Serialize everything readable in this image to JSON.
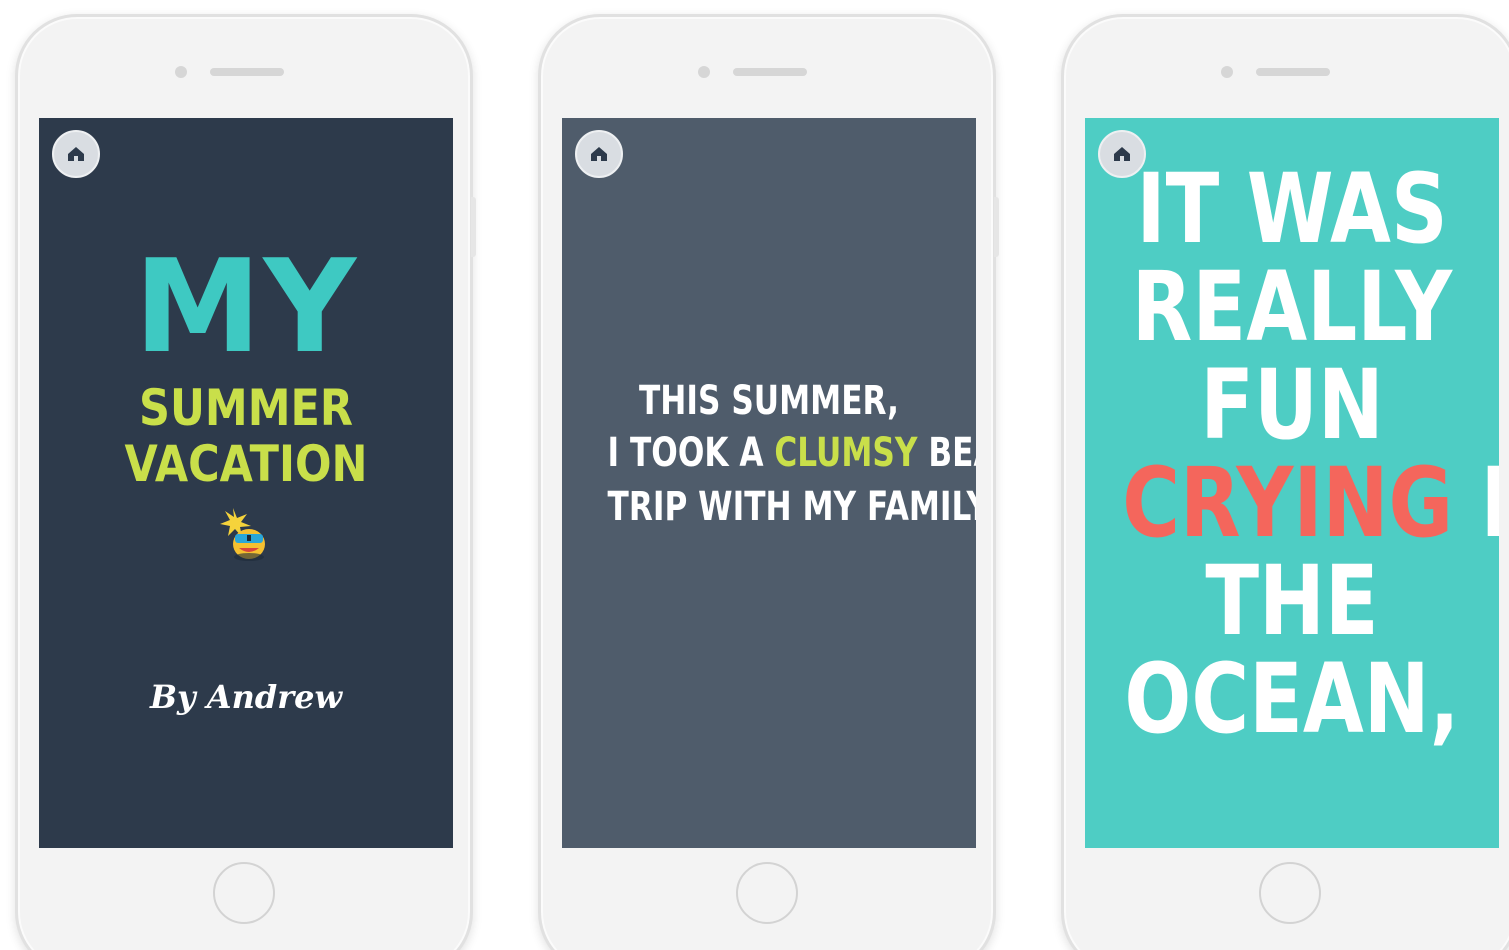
{
  "colors": {
    "screen1_bg": "#2d3a4b",
    "screen2_bg": "#4f5c6b",
    "screen3_bg": "#4ecdc4",
    "teal": "#3ec9c2",
    "lime": "#c9df4a",
    "coral": "#f4665c",
    "white": "#ffffff"
  },
  "icons": {
    "home": "home-icon",
    "mascot": "sunglasses-bomb-mascot"
  },
  "phones": [
    {
      "screen": {
        "title_big": "MY",
        "title_line1": "SUMMER",
        "title_line2": "VACATION",
        "byline": "By Andrew"
      }
    },
    {
      "screen": {
        "line1": "THIS SUMMER,",
        "line2_before": "I TOOK A ",
        "line2_highlight": "CLUMSY",
        "line2_after": " BEACH",
        "line3": "TRIP WITH MY FAMILY."
      }
    },
    {
      "screen": {
        "line1": "IT WAS",
        "line2": "REALLY",
        "line3": "FUN",
        "line4_highlight": "CRYING",
        "line4_after": " IN",
        "line5": "THE",
        "line6": "OCEAN,"
      }
    }
  ]
}
